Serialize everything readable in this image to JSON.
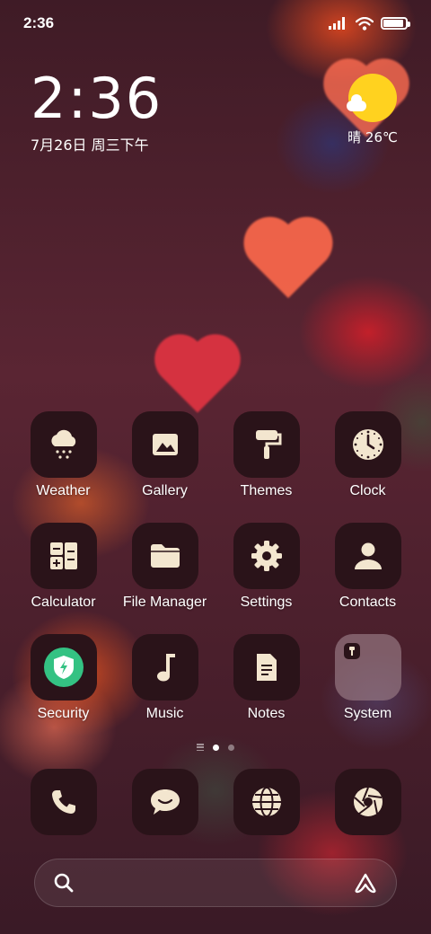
{
  "status_bar": {
    "time": "2:36",
    "battery_level": 0.9,
    "icons": [
      "signal-icon",
      "wifi-icon",
      "battery-icon"
    ]
  },
  "clock_widget": {
    "time": "2:36",
    "date": "7月26日 周三下午"
  },
  "weather_widget": {
    "icon": "partly-sunny-icon",
    "text": "晴 26℃"
  },
  "apps": [
    {
      "label": "Weather",
      "icon": "weather-snow-cloud-icon"
    },
    {
      "label": "Gallery",
      "icon": "gallery-image-icon"
    },
    {
      "label": "Themes",
      "icon": "paint-roller-icon"
    },
    {
      "label": "Clock",
      "icon": "clock-icon"
    },
    {
      "label": "Calculator",
      "icon": "calculator-icon"
    },
    {
      "label": "File Manager",
      "icon": "folder-icon"
    },
    {
      "label": "Settings",
      "icon": "gear-icon"
    },
    {
      "label": "Contacts",
      "icon": "person-icon"
    },
    {
      "label": "Security",
      "icon": "shield-bolt-icon"
    },
    {
      "label": "Music",
      "icon": "music-note-icon"
    },
    {
      "label": "Notes",
      "icon": "note-icon"
    },
    {
      "label": "System",
      "icon": "folder-apps-icon"
    }
  ],
  "page_indicator": {
    "pages": 2,
    "current_page": 1
  },
  "dock": [
    {
      "icon": "phone-icon"
    },
    {
      "icon": "message-icon"
    },
    {
      "icon": "globe-icon"
    },
    {
      "icon": "camera-aperture-icon"
    }
  ],
  "search_bar": {
    "left_icon": "search-icon",
    "right_icon": "assistant-icon"
  },
  "colors": {
    "icon_bg": "#2a1319",
    "glyph": "#f3e6cf",
    "security_green": "#34c283",
    "sun": "#ffd21f"
  }
}
